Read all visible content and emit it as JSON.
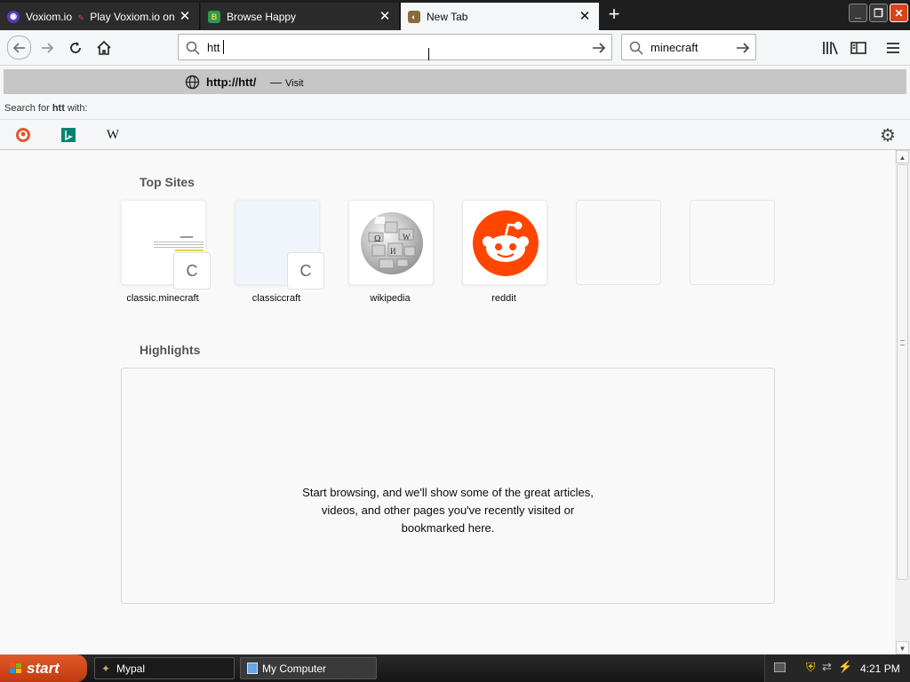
{
  "tabs": [
    {
      "title": "Voxiom.io",
      "subtitle": "Play Voxiom.io on Cr",
      "favicon": "voxiom-icon",
      "active": false
    },
    {
      "title": "Browse Happy",
      "favicon": "browsehappy-icon",
      "active": false
    },
    {
      "title": "New Tab",
      "favicon": "firefox-icon",
      "active": true
    }
  ],
  "urlbar": {
    "value": "htt"
  },
  "searchbar": {
    "value": "minecraft"
  },
  "suggestion": {
    "url": "http://htt/",
    "dash": "—",
    "action": "Visit"
  },
  "search_for": {
    "prefix": "Search for ",
    "term": "htt",
    "suffix": " with:"
  },
  "engines": [
    "duckduckgo-icon",
    "bing-icon",
    "wikipedia-icon"
  ],
  "top_sites": {
    "title": "Top Sites",
    "items": [
      {
        "label": "classic.minecraft",
        "badge": "C"
      },
      {
        "label": "classiccraft",
        "badge": "C"
      },
      {
        "label": "wikipedia"
      },
      {
        "label": "reddit"
      }
    ]
  },
  "highlights": {
    "title": "Highlights",
    "empty_line1": "Start browsing, and we'll show some of the great articles,",
    "empty_line2": "videos, and other pages you've recently visited or",
    "empty_line3": "bookmarked here."
  },
  "taskbar": {
    "start": "start",
    "items": [
      {
        "label": "Mypal"
      },
      {
        "label": "My Computer"
      }
    ],
    "clock": "4:21 PM"
  },
  "colors": {
    "reddit": "#ff4500",
    "start": "#d04a1c"
  }
}
